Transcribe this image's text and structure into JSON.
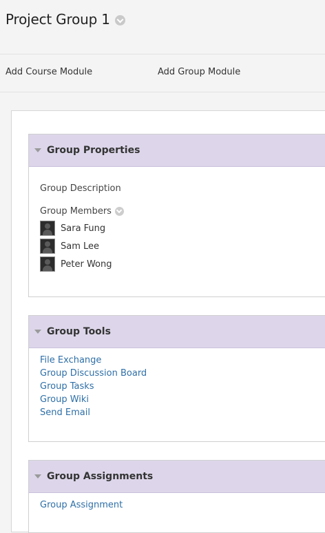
{
  "page": {
    "title": "Project Group 1"
  },
  "toolbar": {
    "add_course_module": "Add Course Module",
    "add_group_module": "Add Group Module"
  },
  "modules": {
    "properties": {
      "title": "Group Properties",
      "description_label": "Group Description",
      "members_label": "Group Members",
      "members": [
        "Sara Fung",
        "Sam Lee",
        "Peter Wong"
      ]
    },
    "tools": {
      "title": "Group Tools",
      "links": [
        "File Exchange",
        "Group Discussion Board",
        "Group Tasks",
        "Group Wiki",
        "Send Email"
      ]
    },
    "assignments": {
      "title": "Group Assignments",
      "links": [
        "Group Assignment"
      ]
    }
  },
  "colors": {
    "module_header_bg": "#ddd6ea",
    "link": "#2e6fa7"
  }
}
